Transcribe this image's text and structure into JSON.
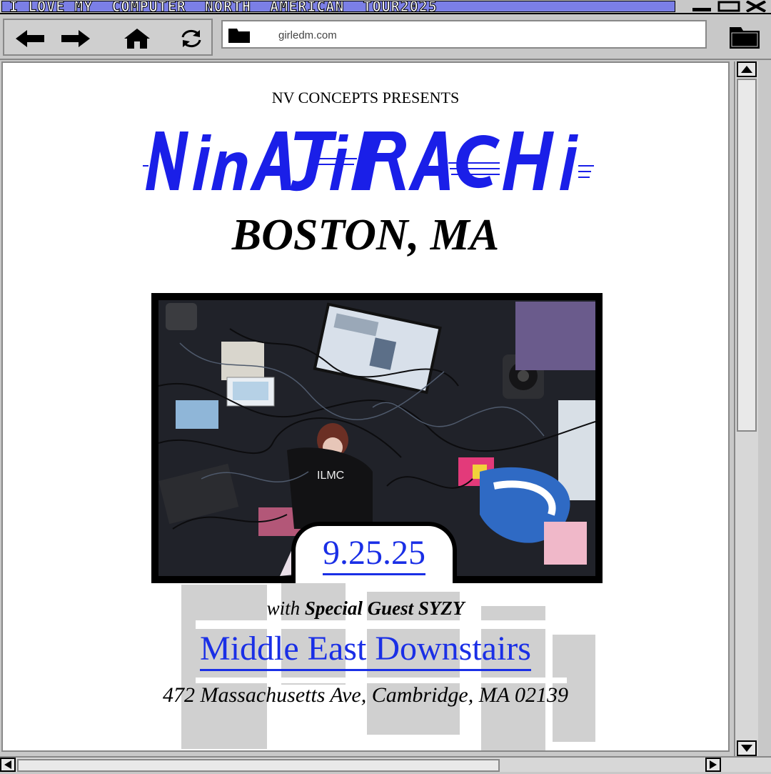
{
  "window": {
    "title": "I_LOVE_MY__COMPUTER__NORTH__AMERICAN__TOUR2025"
  },
  "toolbar": {
    "url": "girledm.com"
  },
  "poster": {
    "presenter": "NV CONCEPTS PRESENTS",
    "artist": "NINAJIRACHI",
    "city": "BOSTON, MA",
    "date": "9.25.25",
    "guest_prefix": "with",
    "guest_label": "Special Guest SYZY",
    "venue": "Middle East Downstairs",
    "address": "472 Massachusetts Ave, Cambridge, MA 02139"
  },
  "colors": {
    "accent": "#1a2fe6",
    "titlebar": "#7b7fe6",
    "chrome": "#c8c8c8"
  }
}
